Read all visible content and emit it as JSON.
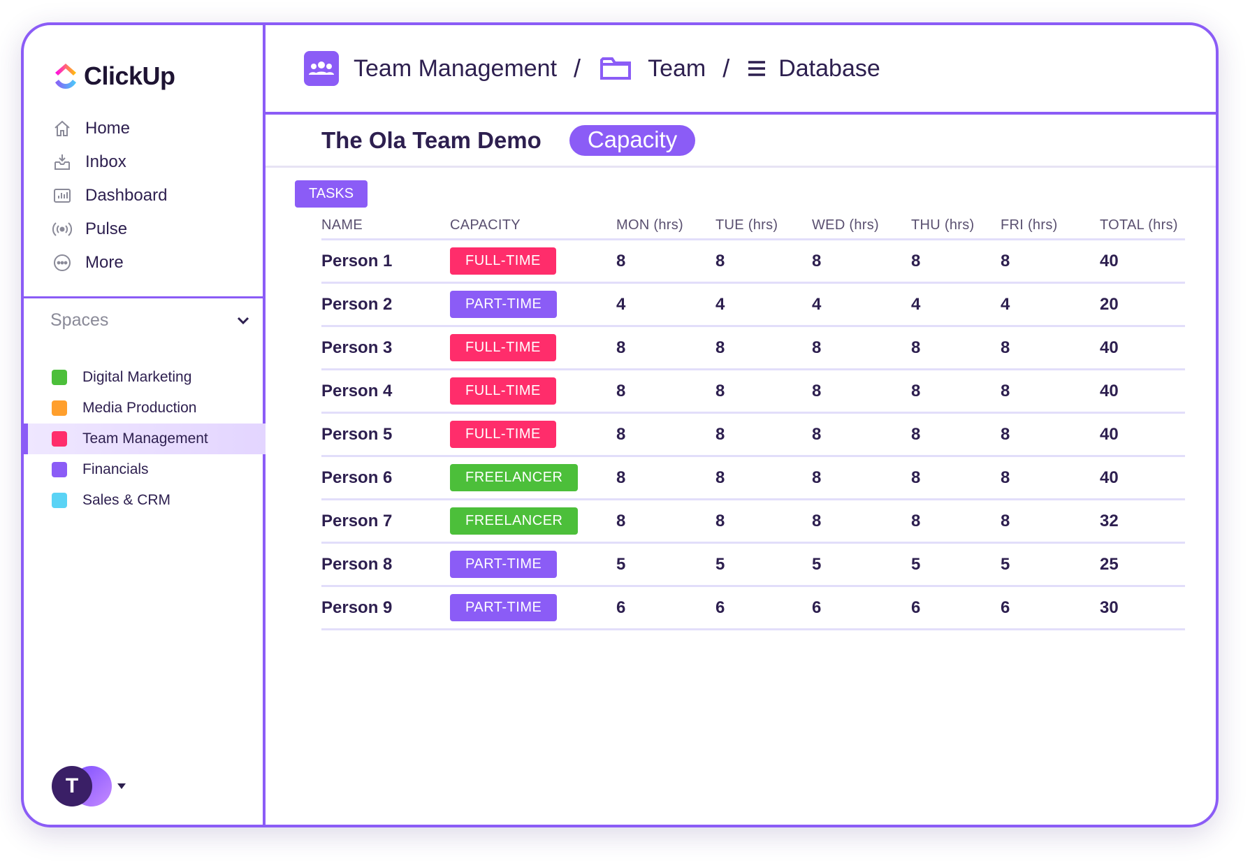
{
  "app": {
    "logo_text": "ClickUp"
  },
  "sidebar": {
    "nav": [
      {
        "label": "Home",
        "icon": "home-icon"
      },
      {
        "label": "Inbox",
        "icon": "inbox-icon"
      },
      {
        "label": "Dashboard",
        "icon": "dashboard-icon"
      },
      {
        "label": "Pulse",
        "icon": "pulse-icon"
      },
      {
        "label": "More",
        "icon": "more-icon"
      }
    ],
    "spaces_label": "Spaces",
    "spaces": [
      {
        "label": "Digital Marketing",
        "color": "#4cbf3a"
      },
      {
        "label": "Media Production",
        "color": "#ff9f2d"
      },
      {
        "label": "Team Management",
        "color": "#ff2d6b",
        "active": true
      },
      {
        "label": "Financials",
        "color": "#8b5cf6"
      },
      {
        "label": "Sales & CRM",
        "color": "#5ad3f5"
      }
    ],
    "avatar_initial": "T"
  },
  "breadcrumb": {
    "items": [
      {
        "label": "Team Management",
        "icon": "team-icon"
      },
      {
        "label": "Team",
        "icon": "folder-icon"
      },
      {
        "label": "Database",
        "icon": "list-icon"
      }
    ],
    "separator": "/"
  },
  "page": {
    "title": "The Ola Team Demo",
    "view": "Capacity",
    "tasks_label": "TASKS"
  },
  "table": {
    "headers": [
      "NAME",
      "CAPACITY",
      "MON (hrs)",
      "TUE (hrs)",
      "WED (hrs)",
      "THU (hrs)",
      "FRI (hrs)",
      "TOTAL (hrs)"
    ],
    "rows": [
      {
        "name": "Person 1",
        "capacity": "FULL-TIME",
        "type": "full",
        "mon": "8",
        "tue": "8",
        "wed": "8",
        "thu": "8",
        "fri": "8",
        "total": "40"
      },
      {
        "name": "Person 2",
        "capacity": "PART-TIME",
        "type": "part",
        "mon": "4",
        "tue": "4",
        "wed": "4",
        "thu": "4",
        "fri": "4",
        "total": "20"
      },
      {
        "name": "Person 3",
        "capacity": "FULL-TIME",
        "type": "full",
        "mon": "8",
        "tue": "8",
        "wed": "8",
        "thu": "8",
        "fri": "8",
        "total": "40"
      },
      {
        "name": "Person 4",
        "capacity": "FULL-TIME",
        "type": "full",
        "mon": "8",
        "tue": "8",
        "wed": "8",
        "thu": "8",
        "fri": "8",
        "total": "40"
      },
      {
        "name": "Person 5",
        "capacity": "FULL-TIME",
        "type": "full",
        "mon": "8",
        "tue": "8",
        "wed": "8",
        "thu": "8",
        "fri": "8",
        "total": "40"
      },
      {
        "name": "Person 6",
        "capacity": "FREELANCER",
        "type": "free",
        "mon": "8",
        "tue": "8",
        "wed": "8",
        "thu": "8",
        "fri": "8",
        "total": "40"
      },
      {
        "name": "Person 7",
        "capacity": "FREELANCER",
        "type": "free",
        "mon": "8",
        "tue": "8",
        "wed": "8",
        "thu": "8",
        "fri": "8",
        "total": "32"
      },
      {
        "name": "Person 8",
        "capacity": "PART-TIME",
        "type": "part",
        "mon": "5",
        "tue": "5",
        "wed": "5",
        "thu": "5",
        "fri": "5",
        "total": "25"
      },
      {
        "name": "Person 9",
        "capacity": "PART-TIME",
        "type": "part",
        "mon": "6",
        "tue": "6",
        "wed": "6",
        "thu": "6",
        "fri": "6",
        "total": "30"
      }
    ]
  },
  "colors": {
    "accent": "#8b5cf6",
    "full_time": "#ff2d6b",
    "part_time": "#8b5cf6",
    "freelancer": "#4cbf3a"
  }
}
